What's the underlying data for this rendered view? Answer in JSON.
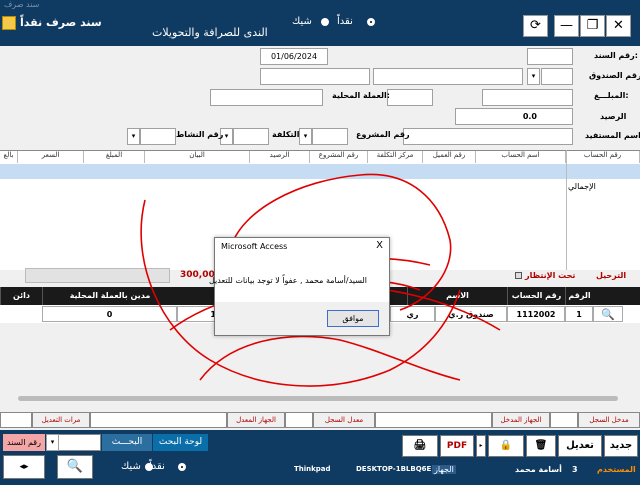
{
  "window": {
    "title_faded": "سند صرف",
    "main_title": "سند صرف نقداً",
    "app_name": "الندى للصرافة والتحويلات"
  },
  "payment_type": {
    "options": [
      "نقداً",
      "شيك"
    ],
    "selected": "نقداً"
  },
  "form": {
    "voucher_no_label": "رقم السند:",
    "date_value": "01/06/2024",
    "fund_no_label": "رقم الصندوق",
    "amount_label": "المبلـــغ:",
    "local_currency_label": "العملة المحلية:",
    "balance_label": "الرصيد",
    "balance_value": "0.0",
    "beneficiary_label": "اسم المستفيد",
    "project_no_label": "رقم المشروع",
    "cost_label": "التكلفة",
    "activity_no_label": "رقم النشاط"
  },
  "grid": {
    "columns": [
      "رقم الحساب",
      "اسم الحساب",
      "رقم العميل",
      "مركز التكلفة",
      "رقم المشروع",
      "الرصيد",
      "البيان",
      "المبلغ",
      "السعر",
      "بالع"
    ],
    "total_label": "الإجمالي"
  },
  "status_row": {
    "posting": "الترحيل",
    "pending": "تحت الإنتظار",
    "total_amount": "300,000"
  },
  "table2": {
    "columns": [
      "الرقم",
      "رقم الحساب",
      "الاسم",
      "",
      "مدين بالعملة المحلية",
      "دائن"
    ],
    "row": {
      "num": "1",
      "account": "1112002",
      "name": "صندوق ر.ي",
      "col4a": "ري",
      "col4b": "1",
      "debit": "0"
    }
  },
  "dialog": {
    "title": "Microsoft Access",
    "close": "X",
    "message": "السيد/أسامة محمد , عفواً لا توجد بيانات للتعديل",
    "ok": "موافق"
  },
  "status_bar": [
    "مدخل السجل",
    "",
    "الجهاز المدخل",
    "",
    "معدل السجل",
    "",
    "الجهاز المعدل",
    "",
    "مرات التعديل",
    ""
  ],
  "bottom": {
    "new": "جديد",
    "edit": "تعديل",
    "user_label": "المستخدم",
    "user_name": "أسامة محمد",
    "user_id": "3",
    "device_label": "الجهاز",
    "device_name": "DESKTOP-1BLBQ6E",
    "device_model": "Thinkpad",
    "search_board": "لوحة البحث",
    "search_label": "البحـــث",
    "voucher_no": "رقم السند",
    "cash": "نقداً",
    "check": "شيك"
  },
  "colors": {
    "header": "#0f3a62",
    "accent_red": "#b00000"
  }
}
